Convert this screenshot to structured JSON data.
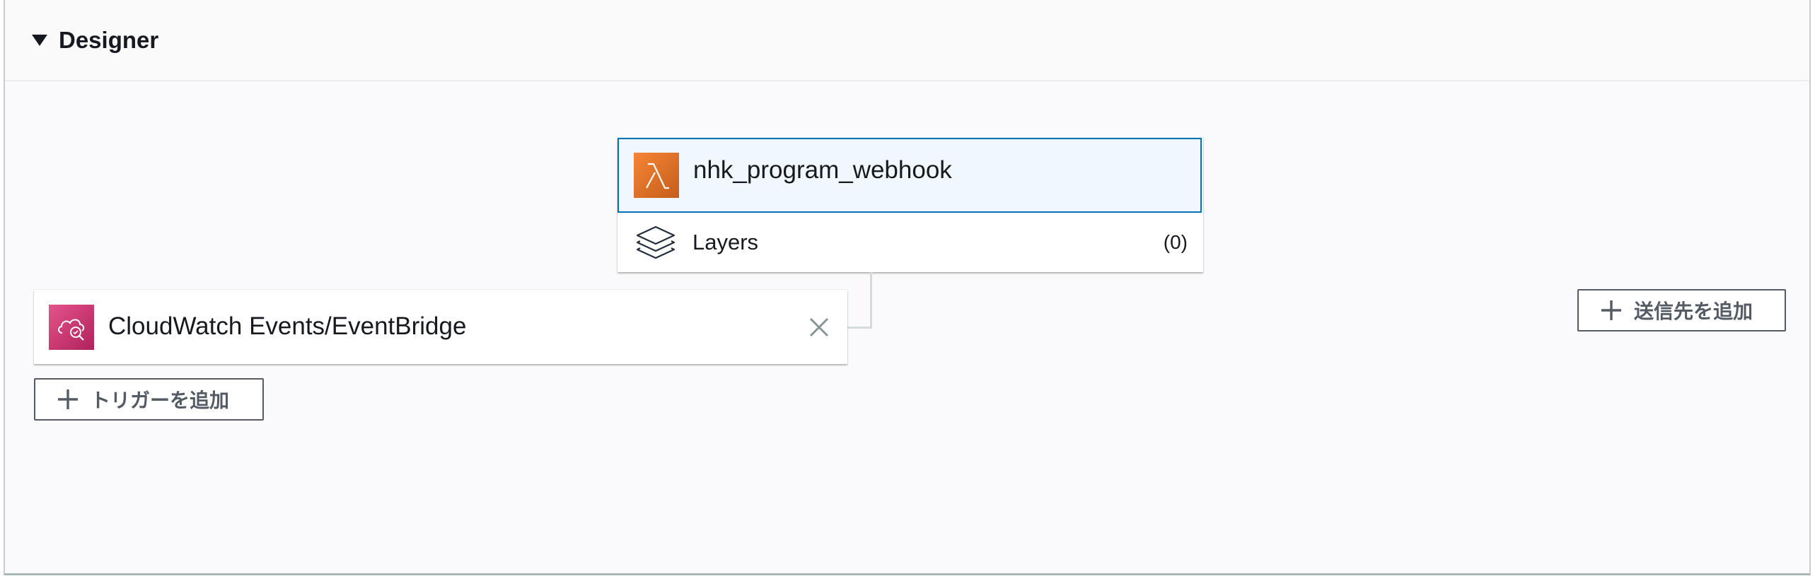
{
  "designer": {
    "title": "Designer"
  },
  "function": {
    "name": "nhk_program_webhook",
    "icon": "lambda-icon",
    "accent_color": "#0073bb",
    "layers": {
      "label": "Layers",
      "count": "(0)"
    }
  },
  "trigger": {
    "name": "CloudWatch Events/EventBridge",
    "icon": "cloudwatch-events-icon",
    "remove_icon": "close-icon"
  },
  "buttons": {
    "add_trigger": "トリガーを追加",
    "add_destination": "送信先を追加"
  }
}
